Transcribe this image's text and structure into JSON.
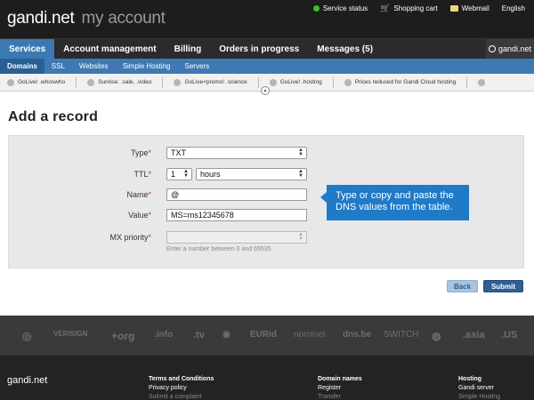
{
  "header": {
    "logo": "gandi.net",
    "logo_suffix": "my account",
    "links": [
      {
        "label": "Service status",
        "icon": "status-dot-icon"
      },
      {
        "label": "Shopping cart",
        "icon": "cart-icon"
      },
      {
        "label": "Webmail",
        "icon": "mail-icon"
      },
      {
        "label": "English",
        "icon": ""
      }
    ]
  },
  "nav": {
    "tabs": [
      {
        "label": "Services",
        "active": true
      },
      {
        "label": "Account management"
      },
      {
        "label": "Billing"
      },
      {
        "label": "Orders in progress"
      },
      {
        "label": "Messages (5)"
      }
    ],
    "brand": "gandi.net"
  },
  "subnav": {
    "tabs": [
      {
        "label": "Domains",
        "active": true
      },
      {
        "label": "SSL"
      },
      {
        "label": "Websites"
      },
      {
        "label": "Simple Hosting"
      },
      {
        "label": "Servers"
      }
    ]
  },
  "promo": {
    "items": [
      "GoLive! .whoswho",
      "Sunrise: .sale, .video",
      "GoLive+promo! .science",
      "GoLive! .hosting",
      "Prices reduced for Gandi Cloud hosting"
    ]
  },
  "page": {
    "title": "Add a record"
  },
  "form": {
    "type_label": "Type",
    "type_value": "TXT",
    "ttl_label": "TTL",
    "ttl_value": "1",
    "ttl_unit": "hours",
    "name_label": "Name",
    "name_value": "@",
    "value_label": "Value",
    "value_value": "MS=ms12345678",
    "mx_label": "MX priority",
    "mx_value": "",
    "required_mark": "*",
    "hint": "Enter a number between 0 and 65535"
  },
  "tooltip": {
    "text": "Type or copy and paste the DNS values from the table."
  },
  "buttons": {
    "back": "Back",
    "submit": "Submit"
  },
  "footer": {
    "logos": [
      "VERISIGN",
      "+org",
      ".info",
      ".tv",
      "EURid",
      "nominet",
      "dns.be",
      "SWITCH",
      ".asia",
      ".US"
    ],
    "brand": "gandi.net",
    "columns": [
      {
        "heading": "Terms and Conditions",
        "items": [
          "Privacy policy",
          "Submit a complaint"
        ]
      },
      {
        "heading": "Domain names",
        "items": [
          "Register",
          "Transfer"
        ]
      },
      {
        "heading": "Hosting",
        "items": [
          "Gandi server",
          "Simple Hosting"
        ]
      }
    ]
  }
}
